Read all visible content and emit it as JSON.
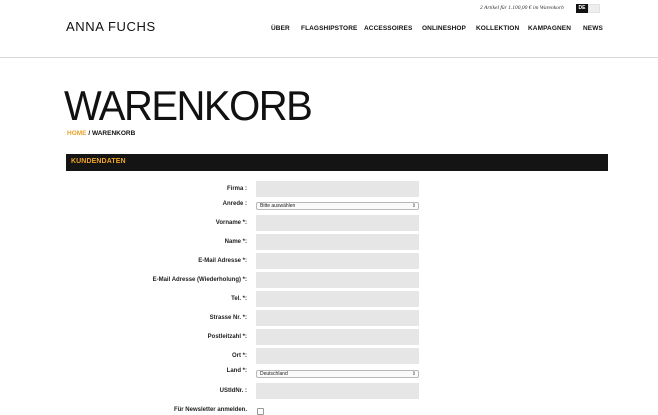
{
  "header": {
    "logo": "ANNA FUCHS",
    "cart_info": "2 Artikel für 1.100,00 € im Warenkorb",
    "languages": [
      {
        "label": "DE",
        "active": true
      },
      {
        "label": "EN",
        "active": false
      }
    ],
    "nav": [
      "ÜBER",
      "FLAGSHIPSTORE",
      "ACCESSOIRES",
      "ONLINESHOP",
      "KOLLEKTION",
      "KAMPAGNEN",
      "NEWS"
    ]
  },
  "page": {
    "title": "WARENKORB",
    "breadcrumb": {
      "home": "HOME",
      "separator": "/",
      "current": "WARENKORB"
    }
  },
  "section": {
    "title": "KUNDENDATEN"
  },
  "form": {
    "firma": {
      "label": "Firma :",
      "value": ""
    },
    "anrede": {
      "label": "Anrede :",
      "selected": "Bitte auswählen"
    },
    "vorname": {
      "label": "Vorname *:",
      "value": ""
    },
    "name": {
      "label": "Name *:",
      "value": ""
    },
    "email": {
      "label": "E-Mail Adresse *:",
      "value": ""
    },
    "email_repeat": {
      "label": "E-Mail Adresse (Wiederholung) *:",
      "value": ""
    },
    "tel": {
      "label": "Tel. *:",
      "value": ""
    },
    "strasse": {
      "label": "Strasse Nr. *:",
      "value": ""
    },
    "plz": {
      "label": "Postleitzahl *:",
      "value": ""
    },
    "ort": {
      "label": "Ort *:",
      "value": ""
    },
    "land": {
      "label": "Land *:",
      "selected": "Deutschland"
    },
    "ustid": {
      "label": "UStIdNr. :",
      "value": ""
    },
    "newsletter": {
      "label": "Für Newsletter anmelden.",
      "checked": false
    }
  },
  "colors": {
    "accent": "#f0a625",
    "bar": "#141414",
    "field": "#e6e6e6"
  }
}
